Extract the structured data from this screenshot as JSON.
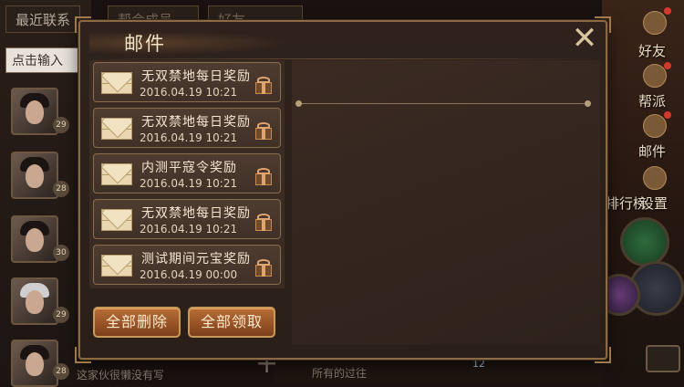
{
  "background": {
    "tabs": [
      "最近联系",
      "帮会成员",
      "好友"
    ],
    "search_placeholder": "点击输入",
    "levels": [
      "29",
      "28",
      "30",
      "29",
      "28"
    ],
    "left_footer": "这家伙很懒没有写",
    "right_nav": [
      "好友",
      "帮派",
      "邮件",
      "排行榜",
      "设置"
    ],
    "bottom_text": "所有的过往",
    "bottom_number": "12"
  },
  "panel": {
    "title": "邮件",
    "close_symbol": "✕"
  },
  "mails": [
    {
      "title": "无双禁地每日奖励",
      "date": "2016.04.19 10:21"
    },
    {
      "title": "无双禁地每日奖励",
      "date": "2016.04.19 10:21"
    },
    {
      "title": "内测平寇令奖励",
      "date": "2016.04.19 10:21"
    },
    {
      "title": "无双禁地每日奖励",
      "date": "2016.04.19 10:21"
    },
    {
      "title": "测试期间元宝奖励",
      "date": "2016.04.19 00:00"
    }
  ],
  "buttons": {
    "delete_all": "全部删除",
    "claim_all": "全部领取"
  },
  "colors": {
    "panel_border": "#8b6a43",
    "button": "#9e5428",
    "title_text": "#f2e4c7",
    "envelope": "#e8d7b0"
  },
  "icons": [
    "envelope-icon",
    "gift-icon",
    "close-icon",
    "plus-icon",
    "gear-icon"
  ]
}
